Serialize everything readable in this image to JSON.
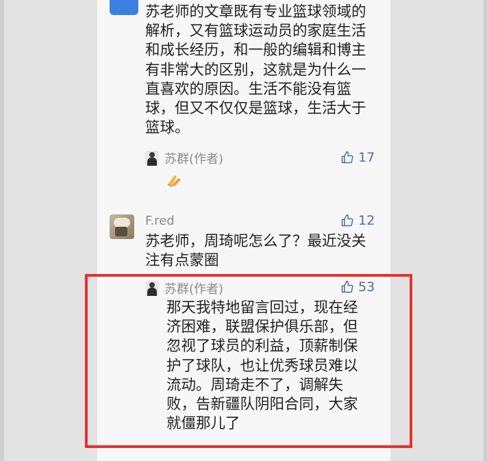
{
  "comments": [
    {
      "text": "苏老师的文章既有专业篮球领域的解析，又有篮球运动员的家庭生活和成长经历，和一般的编辑和博主有非常大的区别，这就是为什么一直喜欢的原因。生活不能没有篮球，但又不仅仅是篮球，生活大于篮球。",
      "reply": {
        "author": "苏群(作者)",
        "likes": "17",
        "emoji": "praying-hands"
      }
    },
    {
      "username": "F.red",
      "likes": "12",
      "text": "苏老师，周琦呢怎么了？最近没关注有点蒙圈",
      "reply": {
        "author": "苏群(作者)",
        "likes": "53",
        "text": "那天我特地留言回过，现在经济困难，联盟保护俱乐部，但忽视了球员的利益，顶薪制保护了球队，也让优秀球员难以流动。周琦走不了，调解失败，告新疆队阴阳合同，大家就僵那儿了"
      }
    }
  ],
  "colors": {
    "highlight_border": "#e8302f",
    "like_icon": "#4a6fa0"
  }
}
